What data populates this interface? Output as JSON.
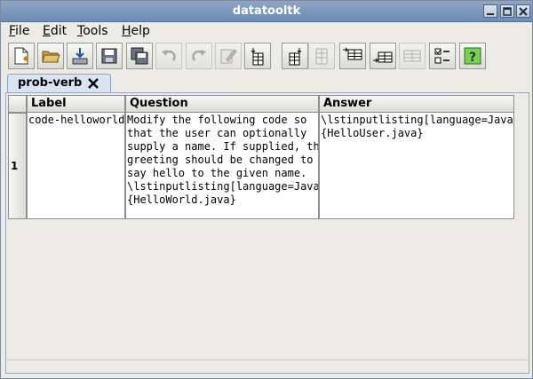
{
  "window": {
    "title": "datatooltk"
  },
  "menubar": {
    "file": {
      "mnemonic": "F",
      "rest": "ile"
    },
    "edit": {
      "mnemonic": "E",
      "rest": "dit"
    },
    "tools": {
      "mnemonic": "T",
      "rest": "ools"
    },
    "help": {
      "mnemonic": "H",
      "rest": "elp"
    }
  },
  "toolbar": {
    "buttons": [
      {
        "icon": "new-file-icon",
        "enabled": true
      },
      {
        "icon": "open-folder-icon",
        "enabled": true
      },
      {
        "icon": "import-icon",
        "enabled": true
      },
      {
        "icon": "save-icon",
        "enabled": true
      },
      {
        "icon": "save-as-icon",
        "enabled": true
      },
      {
        "icon": "undo-icon",
        "enabled": false
      },
      {
        "icon": "redo-icon",
        "enabled": false
      },
      {
        "icon": "edit-cell-icon",
        "enabled": false
      },
      {
        "icon": "insert-column-left-icon",
        "enabled": true
      },
      {
        "icon": "insert-column-right-icon",
        "enabled": true
      },
      {
        "icon": "remove-column-icon",
        "enabled": false
      },
      {
        "icon": "insert-row-above-icon",
        "enabled": true
      },
      {
        "icon": "insert-row-below-icon",
        "enabled": true
      },
      {
        "icon": "remove-row-icon",
        "enabled": false
      },
      {
        "icon": "properties-icon",
        "enabled": true
      },
      {
        "icon": "help-icon",
        "enabled": true
      }
    ]
  },
  "tabs": [
    {
      "label": "prob-verb",
      "active": true
    }
  ],
  "table": {
    "columns": [
      "Label",
      "Question",
      "Answer"
    ],
    "rows": [
      {
        "number": "1",
        "cells": [
          "code-helloworld",
          "Modify the following code so\nthat the user can optionally\nsupply a name. If supplied, the\ngreeting should be changed to\nsay hello to the given name.\n\\lstinputlisting[language=Java]\n{HelloWorld.java}",
          "\\lstinputlisting[language=Java]\n{HelloUser.java}"
        ]
      }
    ]
  },
  "colors": {
    "titlebar": "#7e98bd",
    "tab": "#d9e4f2",
    "help_icon_bg": "#7ccf5a"
  }
}
